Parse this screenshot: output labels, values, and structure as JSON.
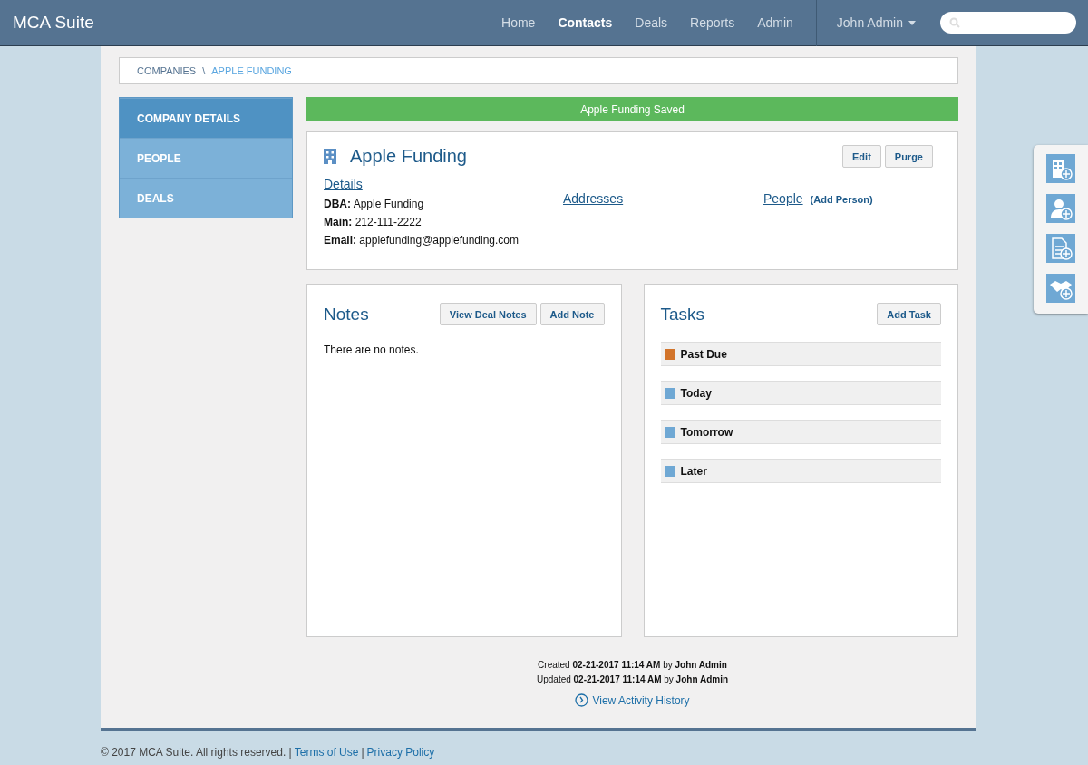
{
  "brand": "MCA Suite",
  "nav": [
    {
      "label": "Home",
      "selected": false
    },
    {
      "label": "Contacts",
      "selected": true
    },
    {
      "label": "Deals",
      "selected": false
    },
    {
      "label": "Reports",
      "selected": false
    },
    {
      "label": "Admin",
      "selected": false
    }
  ],
  "user_menu": {
    "label": "John Admin"
  },
  "breadcrumb": [
    {
      "label": "COMPANIES",
      "selected": false
    },
    {
      "label": "APPLE FUNDING",
      "selected": true
    }
  ],
  "breadcrumb_separator": "\\",
  "sidebar": {
    "items": [
      {
        "label": "COMPANY DETAILS",
        "selected": true
      },
      {
        "label": "PEOPLE",
        "selected": false
      },
      {
        "label": "DEALS",
        "selected": false
      }
    ]
  },
  "alert": "Apple Funding Saved",
  "company": {
    "name": "Apple Funding",
    "buttons": [
      "Edit",
      "Purge"
    ],
    "details_link": "Details",
    "details": [
      {
        "label": "DBA:",
        "value": "Apple Funding"
      },
      {
        "label": "Main:",
        "value": "212-111-2222"
      },
      {
        "label": "Email:",
        "value": "applefunding@applefunding.com"
      }
    ],
    "addresses_link": "Addresses",
    "people_link": "People",
    "add_person": "(Add Person)"
  },
  "notes": {
    "title": "Notes",
    "buttons": [
      "View Deal Notes",
      "Add Note"
    ],
    "empty": "There are no notes."
  },
  "tasks": {
    "title": "Tasks",
    "button": "Add Task",
    "groups": [
      {
        "label": "Past Due",
        "color": "#d2742b"
      },
      {
        "label": "Today",
        "color": "#6fa8d4"
      },
      {
        "label": "Tomorrow",
        "color": "#6fa8d4"
      },
      {
        "label": "Later",
        "color": "#6fa8d4"
      }
    ]
  },
  "meta": [
    "Created **02-21-2017 11:14 AM** by **John Admin**",
    "Updated **02-21-2017 11:14 AM** by **John Admin**"
  ],
  "history_link": "View Activity History",
  "footer": {
    "copyright": "© 2017 MCA Suite. All rights reserved. |",
    "links": [
      "Terms of Use",
      "Privacy Policy"
    ],
    "separator": "|"
  },
  "quick_add": [
    {
      "kind": "company"
    },
    {
      "kind": "person"
    },
    {
      "kind": "document"
    },
    {
      "kind": "deal"
    }
  ]
}
